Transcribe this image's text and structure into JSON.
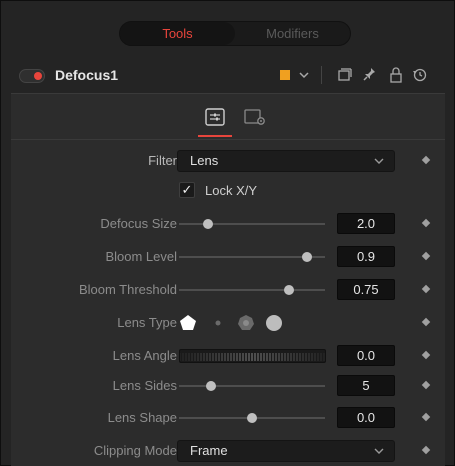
{
  "tabs": {
    "tools": "Tools",
    "modifiers": "Modifiers"
  },
  "node": {
    "name": "Defocus1",
    "color": "#f0a020",
    "enabled": true
  },
  "header_icons": [
    "color-dropdown-chevron-icon",
    "window-icon",
    "pin-icon",
    "lock-icon",
    "reset-icon"
  ],
  "subtabs": {
    "active": "settings-sliders-icon",
    "second": "settings-gear-icon"
  },
  "controls": {
    "filter": {
      "label": "Filter",
      "value": "Lens"
    },
    "lock_xy": {
      "label": "Lock X/Y",
      "checked": true
    },
    "defocus_size": {
      "label": "Defocus Size",
      "value": "2.0",
      "fraction": 0.2
    },
    "bloom_level": {
      "label": "Bloom Level",
      "value": "0.9",
      "fraction": 0.88
    },
    "bloom_threshold": {
      "label": "Bloom Threshold",
      "value": "0.75",
      "fraction": 0.75
    },
    "lens_type": {
      "label": "Lens Type",
      "options": [
        "pentagon",
        "small-circle",
        "heptagon",
        "circle"
      ],
      "selected": "pentagon"
    },
    "lens_angle": {
      "label": "Lens Angle",
      "value": "0.0"
    },
    "lens_sides": {
      "label": "Lens Sides",
      "value": "5",
      "fraction": 0.22
    },
    "lens_shape": {
      "label": "Lens Shape",
      "value": "0.0",
      "fraction": 0.5
    },
    "clipping_mode": {
      "label": "Clipping Mode",
      "value": "Frame"
    }
  },
  "colors": {
    "accent": "#e8453c",
    "panel": "#2c2c2c"
  }
}
